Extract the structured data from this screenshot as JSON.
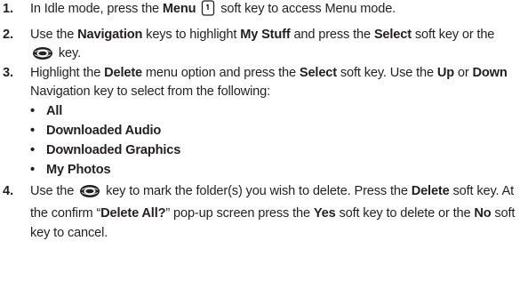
{
  "steps": [
    {
      "number": "1.",
      "parts": [
        "In Idle mode, press the ",
        "Menu",
        " soft key to access Menu mode."
      ]
    },
    {
      "number": "2.",
      "parts": [
        "Use the ",
        "Navigation",
        " keys to highlight ",
        "My Stuff",
        " and press the ",
        "Select",
        " soft key or the ",
        "key."
      ]
    },
    {
      "number": "3.",
      "parts": [
        "Highlight the ",
        "Delete",
        " menu option and press the ",
        "Select",
        " soft key. Use the ",
        "Up",
        " or ",
        "Down",
        " Navigation key to select from the following:"
      ]
    },
    {
      "number": "4.",
      "parts": [
        "Use the ",
        "key to mark the folder(s) you wish to delete. Press the ",
        "Delete",
        " soft key. At the confirm “",
        "Delete All?",
        "” pop-up screen press the ",
        "Yes",
        " soft key to delete or the ",
        "No",
        " soft key to cancel."
      ]
    }
  ],
  "options": [
    "All",
    "Downloaded Audio",
    "Downloaded Graphics",
    "My Photos"
  ],
  "bullet": "•",
  "icons": {
    "menu_key": "soft-key-icon",
    "select_key": "center-select-key-icon"
  }
}
